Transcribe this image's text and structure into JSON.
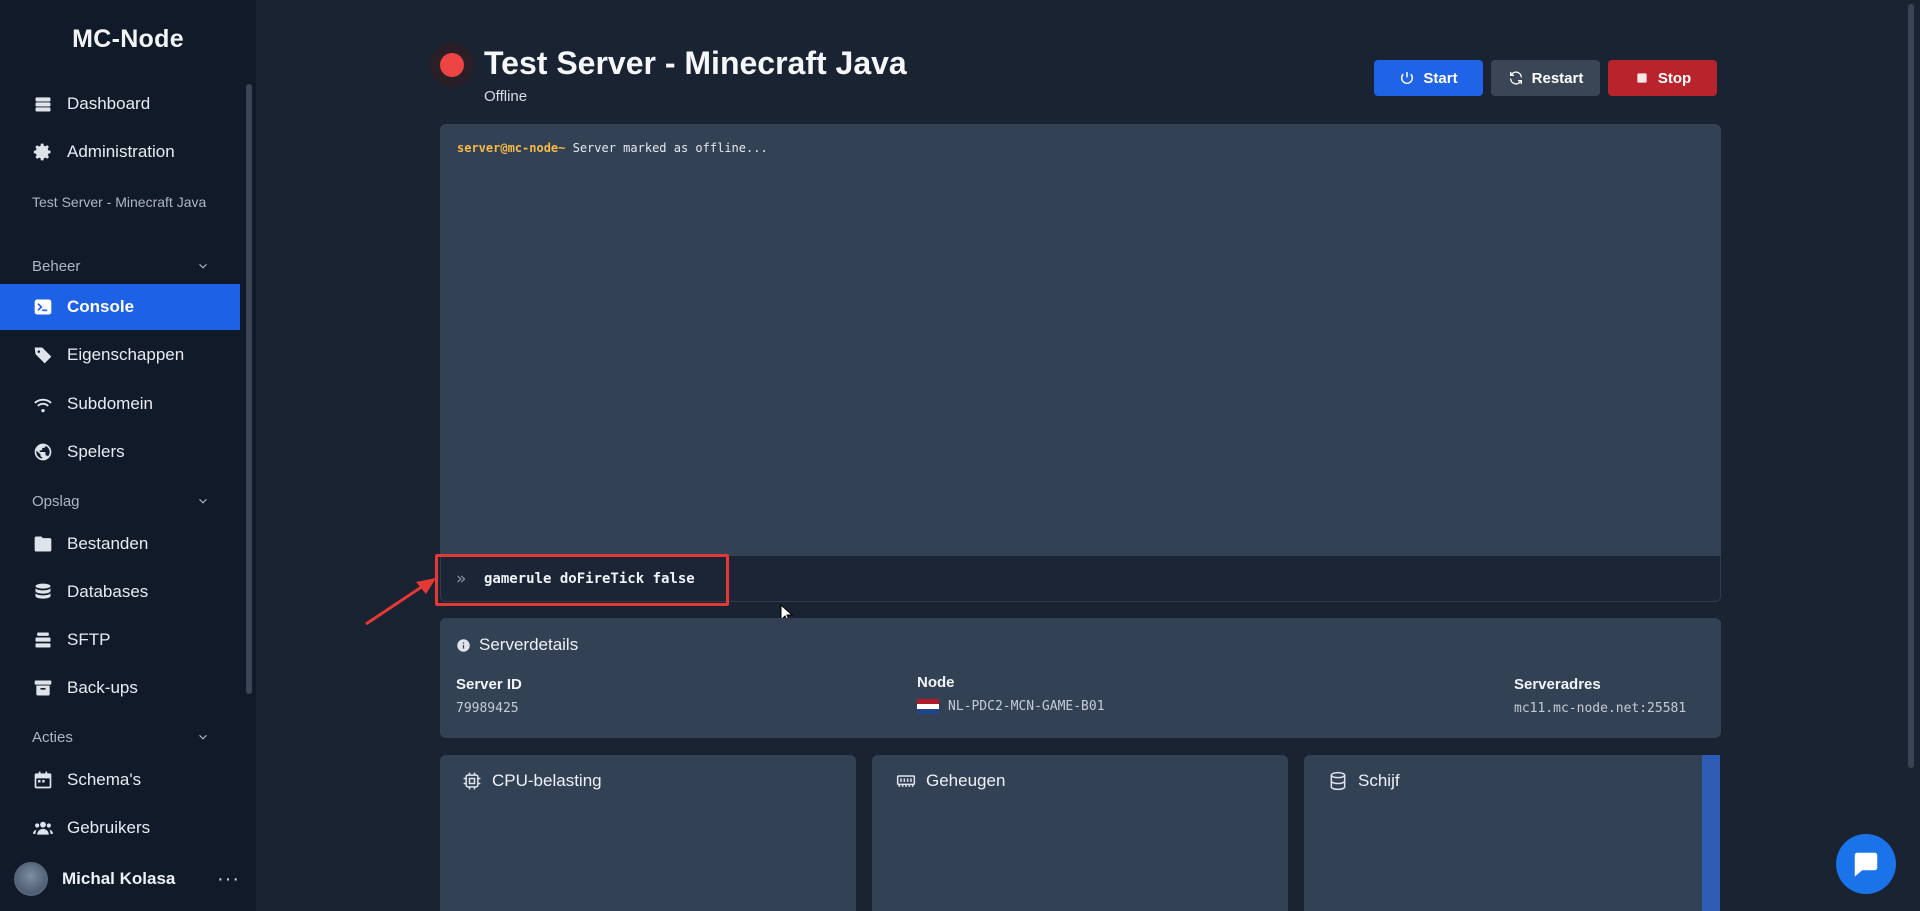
{
  "brand": "MC-Node",
  "sidebar": {
    "top_items": [
      {
        "label": "Dashboard",
        "icon": "server-icon"
      },
      {
        "label": "Administration",
        "icon": "gear-icon"
      }
    ],
    "server_label": "Test Server - Minecraft Java",
    "sections": {
      "beheer": "Beheer",
      "opslag": "Opslag",
      "acties": "Acties"
    },
    "beheer_items": [
      {
        "label": "Console",
        "icon": "terminal-icon",
        "active": true
      },
      {
        "label": "Eigenschappen",
        "icon": "tag-icon"
      },
      {
        "label": "Subdomein",
        "icon": "wifi-icon"
      },
      {
        "label": "Spelers",
        "icon": "globe-icon"
      }
    ],
    "opslag_items": [
      {
        "label": "Bestanden",
        "icon": "folder-icon"
      },
      {
        "label": "Databases",
        "icon": "database-icon"
      },
      {
        "label": "SFTP",
        "icon": "layers-icon"
      },
      {
        "label": "Back-ups",
        "icon": "archive-icon"
      }
    ],
    "acties_items": [
      {
        "label": "Schema's",
        "icon": "calendar-icon"
      },
      {
        "label": "Gebruikers",
        "icon": "users-icon"
      }
    ],
    "user": {
      "name": "Michal Kolasa",
      "menu": "···"
    }
  },
  "header": {
    "title": "Test Server - Minecraft Java",
    "status": "Offline",
    "status_color": "#ef4444",
    "buttons": {
      "start": "Start",
      "restart": "Restart",
      "stop": "Stop"
    }
  },
  "console": {
    "prompt": "server@mc-node~",
    "line": " Server marked as offline...",
    "command_value": "gamerule doFireTick false",
    "chevron": "»"
  },
  "details": {
    "title": "Serverdetails",
    "server_id_label": "Server ID",
    "server_id": "79989425",
    "node_label": "Node",
    "node": "NL-PDC2-MCN-GAME-B01",
    "address_label": "Serveradres",
    "address": "mc11.mc-node.net:25581"
  },
  "cards": {
    "cpu": "CPU-belasting",
    "memory": "Geheugen",
    "disk": "Schijf"
  },
  "colors": {
    "accent": "#1d62e6",
    "stop": "#b9232b",
    "panel": "#334155",
    "highlight": "#e53935"
  }
}
